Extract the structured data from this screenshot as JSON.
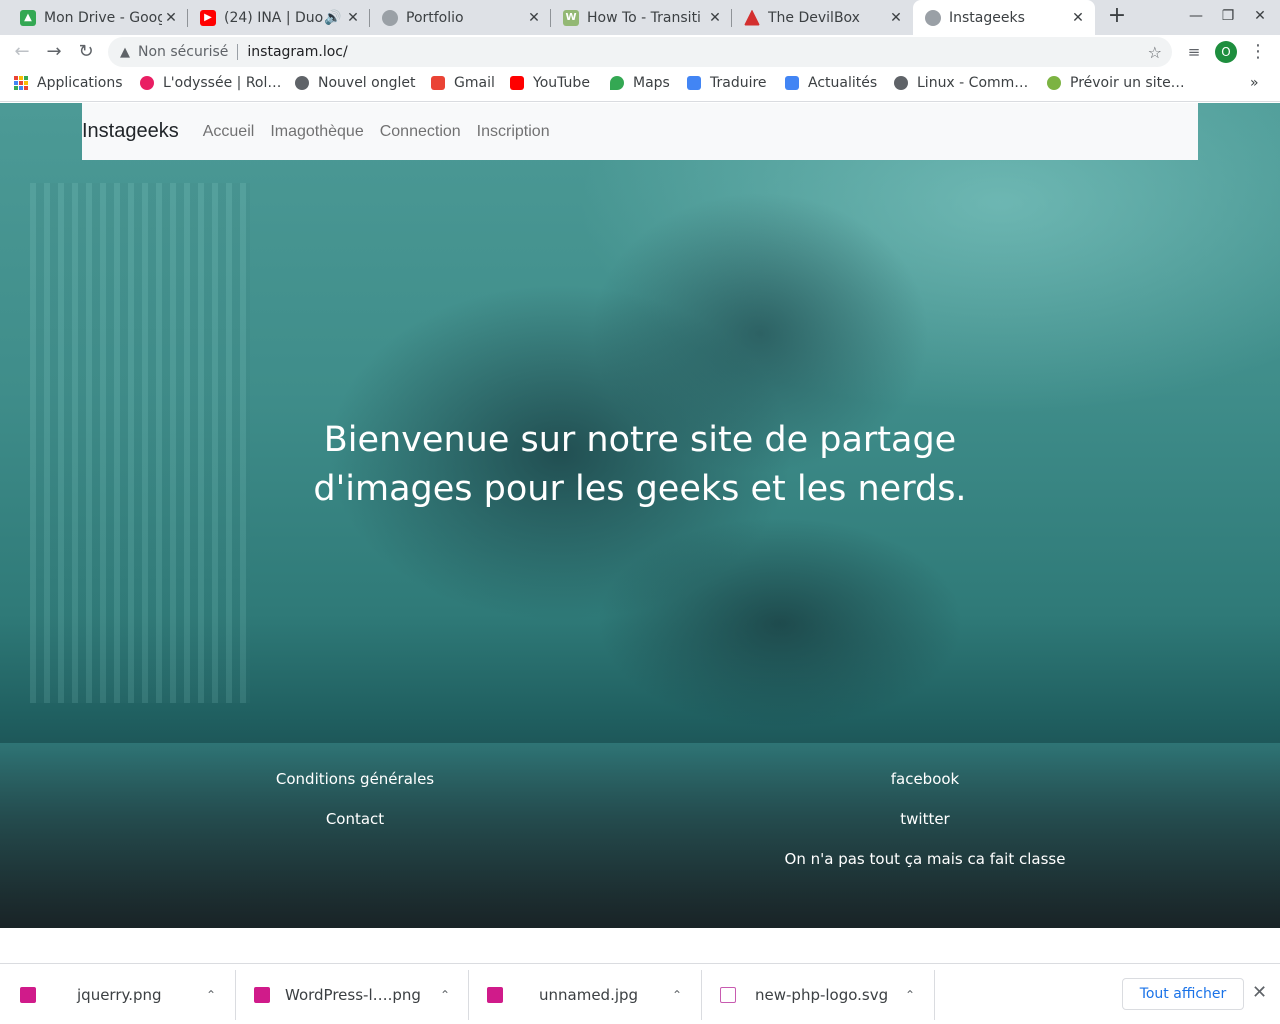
{
  "browser": {
    "tabs": [
      {
        "title": "Mon Drive - Goog",
        "favicon": "google-drive-icon",
        "color": "#34a853"
      },
      {
        "title": "(24) INA | Duo",
        "favicon": "youtube-icon",
        "color": "#ff0000"
      },
      {
        "title": "Portfolio",
        "favicon": "globe-icon",
        "color": "#5f6368"
      },
      {
        "title": "How To - Transiti",
        "favicon": "wikihow-icon",
        "color": "#93b874"
      },
      {
        "title": "The DevilBox",
        "favicon": "devilbox-icon",
        "color": "#d32f2f"
      },
      {
        "title": "Instageeks",
        "favicon": "globe-icon",
        "color": "#5f6368"
      }
    ],
    "address": {
      "security_label": "Non sécurisé",
      "url": "instagram.loc/"
    },
    "profile_initial": "O",
    "bookmarks": [
      {
        "label": "Applications",
        "icon": "apps-grid-icon"
      },
      {
        "label": "L'odyssée | Rol…",
        "icon": "odyssey-icon",
        "color": "#e91e63"
      },
      {
        "label": "Nouvel onglet",
        "icon": "globe-icon",
        "color": "#5f6368"
      },
      {
        "label": "Gmail",
        "icon": "gmail-icon",
        "color": "#ea4335"
      },
      {
        "label": "YouTube",
        "icon": "youtube-icon",
        "color": "#ff0000"
      },
      {
        "label": "Maps",
        "icon": "maps-icon",
        "color": "#34a853"
      },
      {
        "label": "Traduire",
        "icon": "translate-icon",
        "color": "#4285f4"
      },
      {
        "label": "Actualités",
        "icon": "news-icon",
        "color": "#4285f4"
      },
      {
        "label": "Linux - Comm…",
        "icon": "globe-icon",
        "color": "#5f6368"
      },
      {
        "label": "Prévoir un site…",
        "icon": "plant-icon",
        "color": "#7cb342"
      }
    ]
  },
  "site": {
    "brand": "Instageeks",
    "nav": [
      "Accueil",
      "Imagothèque",
      "Connection",
      "Inscription"
    ],
    "hero_line1": "Bienvenue sur notre site de partage",
    "hero_line2": "d'images pour les geeks et les nerds.",
    "footer": {
      "conditions": "Conditions générales",
      "contact": "Contact",
      "facebook": "facebook",
      "twitter": "twitter",
      "tagline": "On n'a pas tout ça mais ca fait classe"
    }
  },
  "downloads": {
    "items": [
      {
        "name": "jquerry.png",
        "type": "image"
      },
      {
        "name": "WordPress-l….png",
        "type": "image"
      },
      {
        "name": "unnamed.jpg",
        "type": "image"
      },
      {
        "name": "new-php-logo.svg",
        "type": "svg"
      }
    ],
    "show_all": "Tout afficher"
  }
}
